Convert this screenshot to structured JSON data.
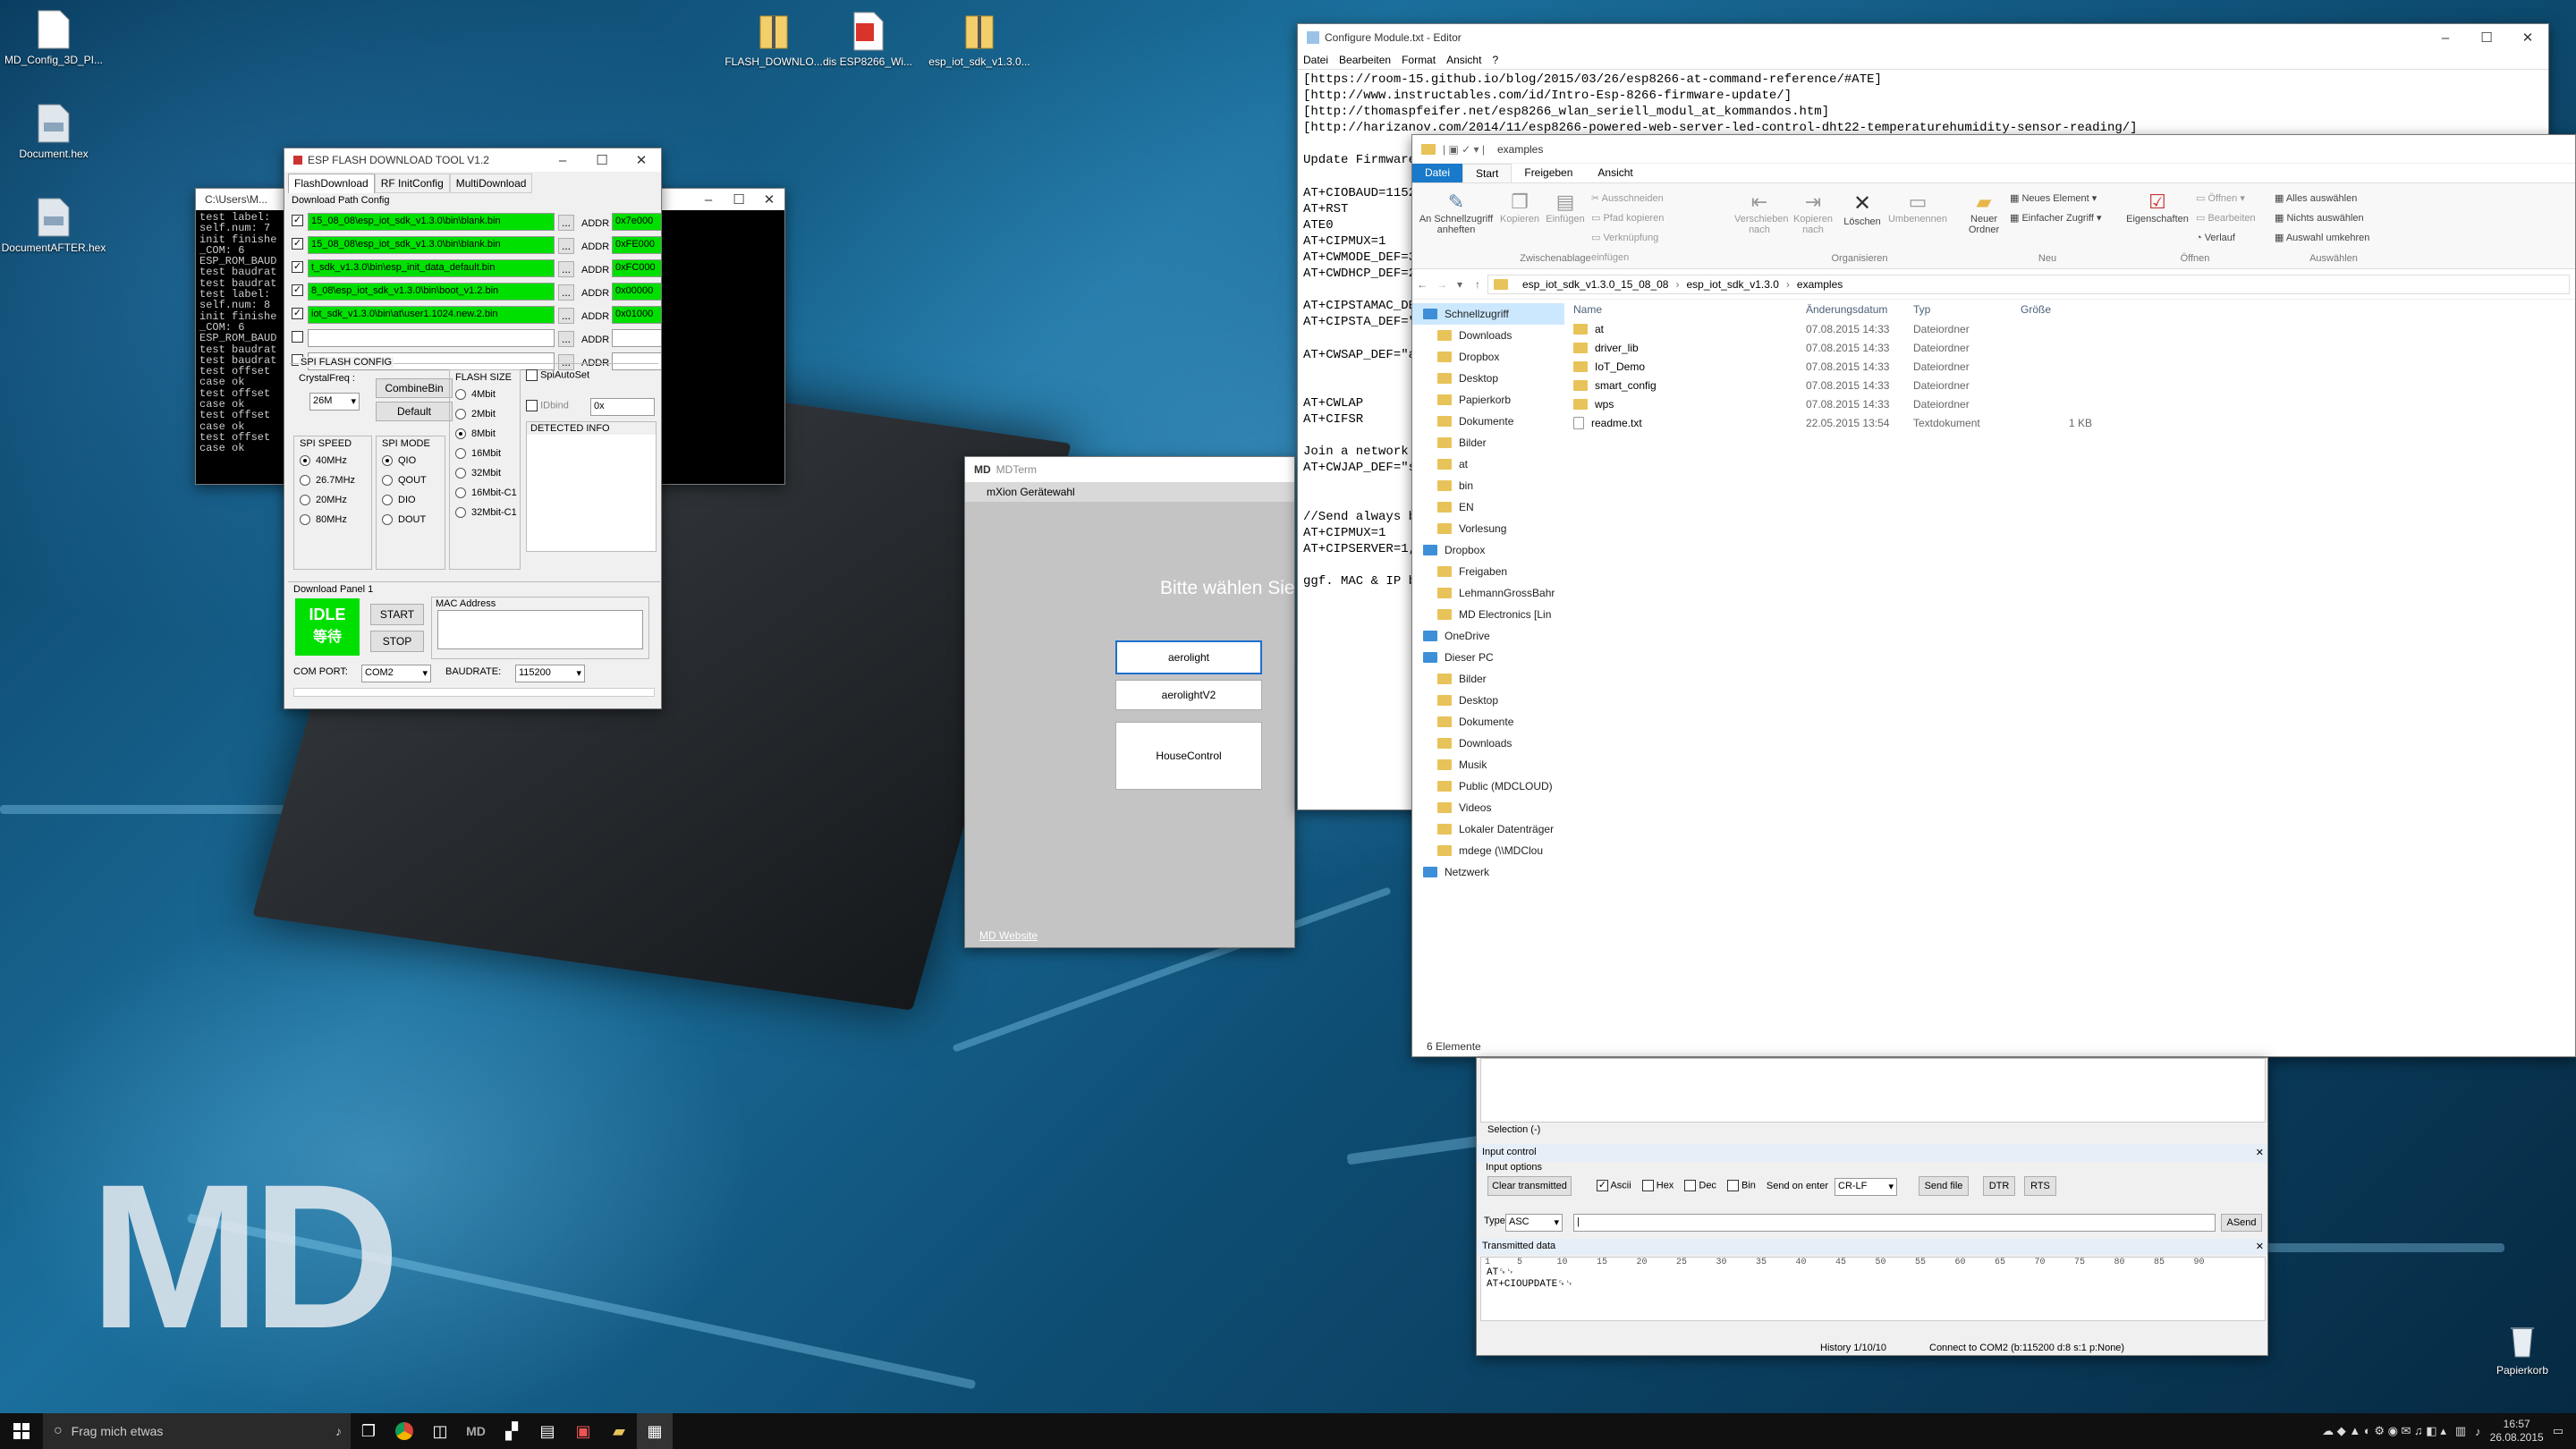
{
  "desktop": {
    "icons": [
      {
        "label": "MD_Config_3D_PI...",
        "icon": "file-icon"
      },
      {
        "label": "Document.hex",
        "icon": "hex-file-icon"
      },
      {
        "label": "DocumentAFTER.hex",
        "icon": "hex-file-icon"
      },
      {
        "label": "FLASH_DOWNLO...",
        "icon": "zip-folder-icon"
      },
      {
        "label": "dis ESP8266_Wi...",
        "icon": "pdf-file-icon"
      },
      {
        "label": "esp_iot_sdk_v1.3.0...",
        "icon": "zip-folder-icon"
      },
      {
        "label": "Papierkorb",
        "icon": "recycle-bin-icon"
      }
    ],
    "logo": "MD"
  },
  "cmd": {
    "title": "C:\\Users\\M...",
    "lines": [
      "test label:",
      "self.num: 7",
      "init finishe",
      "_COM: 6",
      "ESP_ROM_BAUD",
      "test baudrat",
      "test baudrat",
      "test label:",
      "self.num: 8",
      "init finishe",
      "_COM: 6",
      "ESP_ROM_BAUD",
      "test baudrat",
      "test baudrat",
      "test offset",
      "case ok",
      "test offset",
      "case ok",
      "test offset",
      "case ok",
      "test offset",
      "case ok"
    ]
  },
  "esptool": {
    "title": "ESP FLASH DOWNLOAD TOOL V1.2",
    "tabs": [
      "FlashDownload",
      "RF InitConfig",
      "MultiDownload"
    ],
    "path_group": "Download Path Config",
    "rows": [
      {
        "checked": true,
        "path": "15_08_08\\esp_iot_sdk_v1.3.0\\bin\\blank.bin",
        "addr_label": "ADDR",
        "addr": "0x7e000"
      },
      {
        "checked": true,
        "path": "15_08_08\\esp_iot_sdk_v1.3.0\\bin\\blank.bin",
        "addr_label": "ADDR",
        "addr": "0xFE000"
      },
      {
        "checked": true,
        "path": "t_sdk_v1.3.0\\bin\\esp_init_data_default.bin",
        "addr_label": "ADDR",
        "addr": "0xFC000"
      },
      {
        "checked": true,
        "path": "8_08\\esp_iot_sdk_v1.3.0\\bin\\boot_v1.2.bin",
        "addr_label": "ADDR",
        "addr": "0x00000"
      },
      {
        "checked": true,
        "path": "iot_sdk_v1.3.0\\bin\\at\\user1.1024.new.2.bin",
        "addr_label": "ADDR",
        "addr": "0x01000"
      },
      {
        "checked": false,
        "path": "",
        "addr_label": "ADDR",
        "addr": ""
      },
      {
        "checked": false,
        "path": "",
        "addr_label": "ADDR",
        "addr": ""
      }
    ],
    "browse": "...",
    "spi_group": "SPI FLASH CONFIG",
    "crystal_label": "CrystalFreq :",
    "crystal_value": "26M",
    "combine_btn": "CombineBin",
    "default_btn": "Default",
    "flash_size_label": "FLASH SIZE",
    "flash_sizes": [
      "4Mbit",
      "2Mbit",
      "8Mbit",
      "16Mbit",
      "32Mbit",
      "16Mbit-C1",
      "32Mbit-C1"
    ],
    "flash_selected": 2,
    "spi_auto": "SpiAutoSet",
    "idbind": "IDbind",
    "idbind_value": "0x",
    "detected": "DETECTED INFO",
    "speed_label": "SPI SPEED",
    "speeds": [
      "40MHz",
      "26.7MHz",
      "20MHz",
      "80MHz"
    ],
    "speed_selected": 0,
    "mode_label": "SPI MODE",
    "modes": [
      "QIO",
      "QOUT",
      "DIO",
      "DOUT"
    ],
    "mode_selected": 0,
    "panel_label": "Download Panel 1",
    "status": "IDLE",
    "status_sub": "等待",
    "start": "START",
    "stop": "STOP",
    "mac_label": "MAC Address",
    "com_label": "COM PORT:",
    "com_value": "COM2",
    "baud_label": "BAUDRATE:",
    "baud_value": "115200"
  },
  "mdterm": {
    "title": "MDTerm",
    "header": "mXion Gerätewahl",
    "prompt": "Bitte wählen Sie",
    "devices": [
      "aerolight",
      "aerolightV2",
      "HouseControl"
    ],
    "link": "MD Website"
  },
  "editor": {
    "title": "Configure Module.txt - Editor",
    "menu": [
      "Datei",
      "Bearbeiten",
      "Format",
      "Ansicht",
      "?"
    ],
    "lines": [
      "[https://room-15.github.io/blog/2015/03/26/esp8266-at-command-reference/#ATE]",
      "[http://www.instructables.com/id/Intro-Esp-8266-firmware-update/]",
      "[http://thomaspfeifer.net/esp8266_wlan_seriell_modul_at_kommandos.htm]",
      "[http://harizanov.com/2014/11/esp8266-powered-web-server-led-control-dht22-temperaturehumidity-sensor-reading/]",
      "",
      "Update Firmware",
      "",
      "AT+CIOBAUD=11520",
      "AT+RST",
      "ATE0",
      "AT+CIPMUX=1",
      "AT+CWMODE_DEF=3",
      "AT+CWDHCP_DEF=2",
      "",
      "AT+CIPSTAMAC_DE",
      "AT+CIPSTA_DEF=\"",
      "",
      "AT+CWSAP_DEF=\"a",
      "",
      "",
      "AT+CWLAP",
      "AT+CIFSR",
      "",
      "Join a network w",
      "AT+CWJAP_DEF=\"s",
      "",
      "",
      "//Send always by",
      "AT+CIPMUX=1",
      "AT+CIPSERVER=1,",
      "",
      "ggf. MAC & IP by"
    ]
  },
  "explorer": {
    "title": "examples",
    "ribbon_tabs": [
      "Datei",
      "Start",
      "Freigeben",
      "Ansicht"
    ],
    "ribbon": {
      "pin": "An Schnellzugriff anheften",
      "copy": "Kopieren",
      "paste": "Einfügen",
      "cut": "Ausschneiden",
      "copy_path": "Pfad kopieren",
      "paste_link": "Verknüpfung einfügen",
      "clipboard": "Zwischenablage",
      "move": "Verschieben nach",
      "copyto": "Kopieren nach",
      "delete": "Löschen",
      "rename": "Umbenennen",
      "organize": "Organisieren",
      "newfolder": "Neuer Ordner",
      "newitem": "Neues Element",
      "easyaccess": "Einfacher Zugriff",
      "new": "Neu",
      "props": "Eigenschaften",
      "open": "Öffnen",
      "edit": "Bearbeiten",
      "history": "Verlauf",
      "open_group": "Öffnen",
      "selall": "Alles auswählen",
      "selnone": "Nichts auswählen",
      "selinv": "Auswahl umkehren",
      "select": "Auswählen"
    },
    "breadcrumb": [
      "esp_iot_sdk_v1.3.0_15_08_08",
      "esp_iot_sdk_v1.3.0",
      "examples"
    ],
    "nav": [
      {
        "label": "Schnellzugriff",
        "level": 0,
        "sel": true
      },
      {
        "label": "Downloads",
        "level": 1
      },
      {
        "label": "Dropbox",
        "level": 1
      },
      {
        "label": "Desktop",
        "level": 1
      },
      {
        "label": "Papierkorb",
        "level": 1
      },
      {
        "label": "Dokumente",
        "level": 1
      },
      {
        "label": "Bilder",
        "level": 1
      },
      {
        "label": "at",
        "level": 1
      },
      {
        "label": "bin",
        "level": 1
      },
      {
        "label": "EN",
        "level": 1
      },
      {
        "label": "Vorlesung",
        "level": 1
      },
      {
        "label": "Dropbox",
        "level": 0
      },
      {
        "label": "Freigaben",
        "level": 1
      },
      {
        "label": "LehmannGrossBahr",
        "level": 1
      },
      {
        "label": "MD Electronics [Lin",
        "level": 1
      },
      {
        "label": "OneDrive",
        "level": 0
      },
      {
        "label": "Dieser PC",
        "level": 0
      },
      {
        "label": "Bilder",
        "level": 1
      },
      {
        "label": "Desktop",
        "level": 1
      },
      {
        "label": "Dokumente",
        "level": 1
      },
      {
        "label": "Downloads",
        "level": 1
      },
      {
        "label": "Musik",
        "level": 1
      },
      {
        "label": "Public (MDCLOUD)",
        "level": 1
      },
      {
        "label": "Videos",
        "level": 1
      },
      {
        "label": "Lokaler Datenträger",
        "level": 1
      },
      {
        "label": "mdege (\\\\MDClou",
        "level": 1
      },
      {
        "label": "Netzwerk",
        "level": 0
      }
    ],
    "columns": [
      "Name",
      "Änderungsdatum",
      "Typ",
      "Größe"
    ],
    "files": [
      {
        "name": "at",
        "date": "07.08.2015 14:33",
        "type": "Dateiordner",
        "size": ""
      },
      {
        "name": "driver_lib",
        "date": "07.08.2015 14:33",
        "type": "Dateiordner",
        "size": ""
      },
      {
        "name": "IoT_Demo",
        "date": "07.08.2015 14:33",
        "type": "Dateiordner",
        "size": ""
      },
      {
        "name": "smart_config",
        "date": "07.08.2015 14:33",
        "type": "Dateiordner",
        "size": ""
      },
      {
        "name": "wps",
        "date": "07.08.2015 14:33",
        "type": "Dateiordner",
        "size": ""
      },
      {
        "name": "readme.txt",
        "date": "22.05.2015 13:54",
        "type": "Textdokument",
        "size": "1 KB"
      }
    ],
    "count": "6 Elemente"
  },
  "terminal": {
    "selection": "Selection (-)",
    "input_control": "Input control",
    "input_options": "Input options",
    "clear": "Clear transmitted",
    "ascii": "Ascii",
    "hex": "Hex",
    "dec": "Dec",
    "bin": "Bin",
    "send_on_enter": "Send on enter",
    "send_mode": "CR-LF",
    "send_file": "Send file",
    "dtr": "DTR",
    "rts": "RTS",
    "type_label": "Type",
    "type_value": "ASC",
    "asend": "ASend",
    "transmitted": "Transmitted data",
    "ruler": [
      "1",
      "5",
      "10",
      "15",
      "20",
      "25",
      "30",
      "35",
      "40",
      "45",
      "50",
      "55",
      "60",
      "65",
      "70",
      "75",
      "80",
      "85",
      "90"
    ],
    "tx_lines": [
      "AT␍␊",
      "AT+CIOUPDATE␍␊"
    ],
    "history": "History 1/10/10",
    "status": "Connect to COM2 (b:115200 d:8 s:1 p:None)"
  },
  "taskbar": {
    "search": "Frag mich etwas",
    "time": "16:57",
    "date": "26.08.2015"
  }
}
